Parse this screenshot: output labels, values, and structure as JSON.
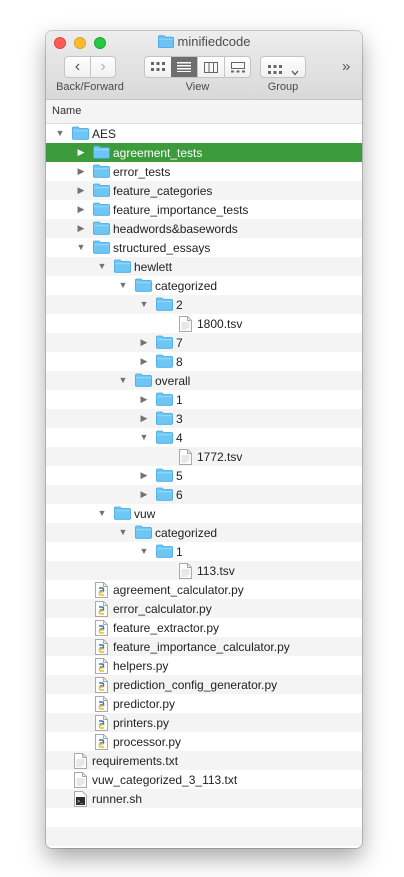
{
  "window": {
    "title": "minifiedcode"
  },
  "toolbar": {
    "back_forward_label": "Back/Forward",
    "view_label": "View",
    "group_label": "Group"
  },
  "list_header": {
    "name": "Name"
  },
  "accent_color": "#3c9c3c",
  "rows": [
    {
      "label": "AES",
      "depth": 0,
      "kind": "folder",
      "state": "open"
    },
    {
      "label": "agreement_tests",
      "depth": 1,
      "kind": "folder",
      "state": "closed",
      "selected": true
    },
    {
      "label": "error_tests",
      "depth": 1,
      "kind": "folder",
      "state": "closed"
    },
    {
      "label": "feature_categories",
      "depth": 1,
      "kind": "folder",
      "state": "closed"
    },
    {
      "label": "feature_importance_tests",
      "depth": 1,
      "kind": "folder",
      "state": "closed"
    },
    {
      "label": "headwords&basewords",
      "depth": 1,
      "kind": "folder",
      "state": "closed"
    },
    {
      "label": "structured_essays",
      "depth": 1,
      "kind": "folder",
      "state": "open"
    },
    {
      "label": "hewlett",
      "depth": 2,
      "kind": "folder",
      "state": "open"
    },
    {
      "label": "categorized",
      "depth": 3,
      "kind": "folder",
      "state": "open"
    },
    {
      "label": "2",
      "depth": 4,
      "kind": "folder",
      "state": "open"
    },
    {
      "label": "1800.tsv",
      "depth": 5,
      "kind": "doc"
    },
    {
      "label": "7",
      "depth": 4,
      "kind": "folder",
      "state": "closed"
    },
    {
      "label": "8",
      "depth": 4,
      "kind": "folder",
      "state": "closed"
    },
    {
      "label": "overall",
      "depth": 3,
      "kind": "folder",
      "state": "open"
    },
    {
      "label": "1",
      "depth": 4,
      "kind": "folder",
      "state": "closed"
    },
    {
      "label": "3",
      "depth": 4,
      "kind": "folder",
      "state": "closed"
    },
    {
      "label": "4",
      "depth": 4,
      "kind": "folder",
      "state": "open"
    },
    {
      "label": "1772.tsv",
      "depth": 5,
      "kind": "doc"
    },
    {
      "label": "5",
      "depth": 4,
      "kind": "folder",
      "state": "closed"
    },
    {
      "label": "6",
      "depth": 4,
      "kind": "folder",
      "state": "closed"
    },
    {
      "label": "vuw",
      "depth": 2,
      "kind": "folder",
      "state": "open"
    },
    {
      "label": "categorized",
      "depth": 3,
      "kind": "folder",
      "state": "open"
    },
    {
      "label": "1",
      "depth": 4,
      "kind": "folder",
      "state": "open"
    },
    {
      "label": "113.tsv",
      "depth": 5,
      "kind": "doc"
    },
    {
      "label": "agreement_calculator.py",
      "depth": 1,
      "kind": "py"
    },
    {
      "label": "error_calculator.py",
      "depth": 1,
      "kind": "py"
    },
    {
      "label": "feature_extractor.py",
      "depth": 1,
      "kind": "py"
    },
    {
      "label": "feature_importance_calculator.py",
      "depth": 1,
      "kind": "py"
    },
    {
      "label": "helpers.py",
      "depth": 1,
      "kind": "py"
    },
    {
      "label": "prediction_config_generator.py",
      "depth": 1,
      "kind": "py"
    },
    {
      "label": "predictor.py",
      "depth": 1,
      "kind": "py"
    },
    {
      "label": "printers.py",
      "depth": 1,
      "kind": "py"
    },
    {
      "label": "processor.py",
      "depth": 1,
      "kind": "py"
    },
    {
      "label": "requirements.txt",
      "depth": 0,
      "kind": "doc"
    },
    {
      "label": "vuw_categorized_3_113.txt",
      "depth": 0,
      "kind": "doc"
    },
    {
      "label": "runner.sh",
      "depth": 0,
      "kind": "sh"
    }
  ]
}
